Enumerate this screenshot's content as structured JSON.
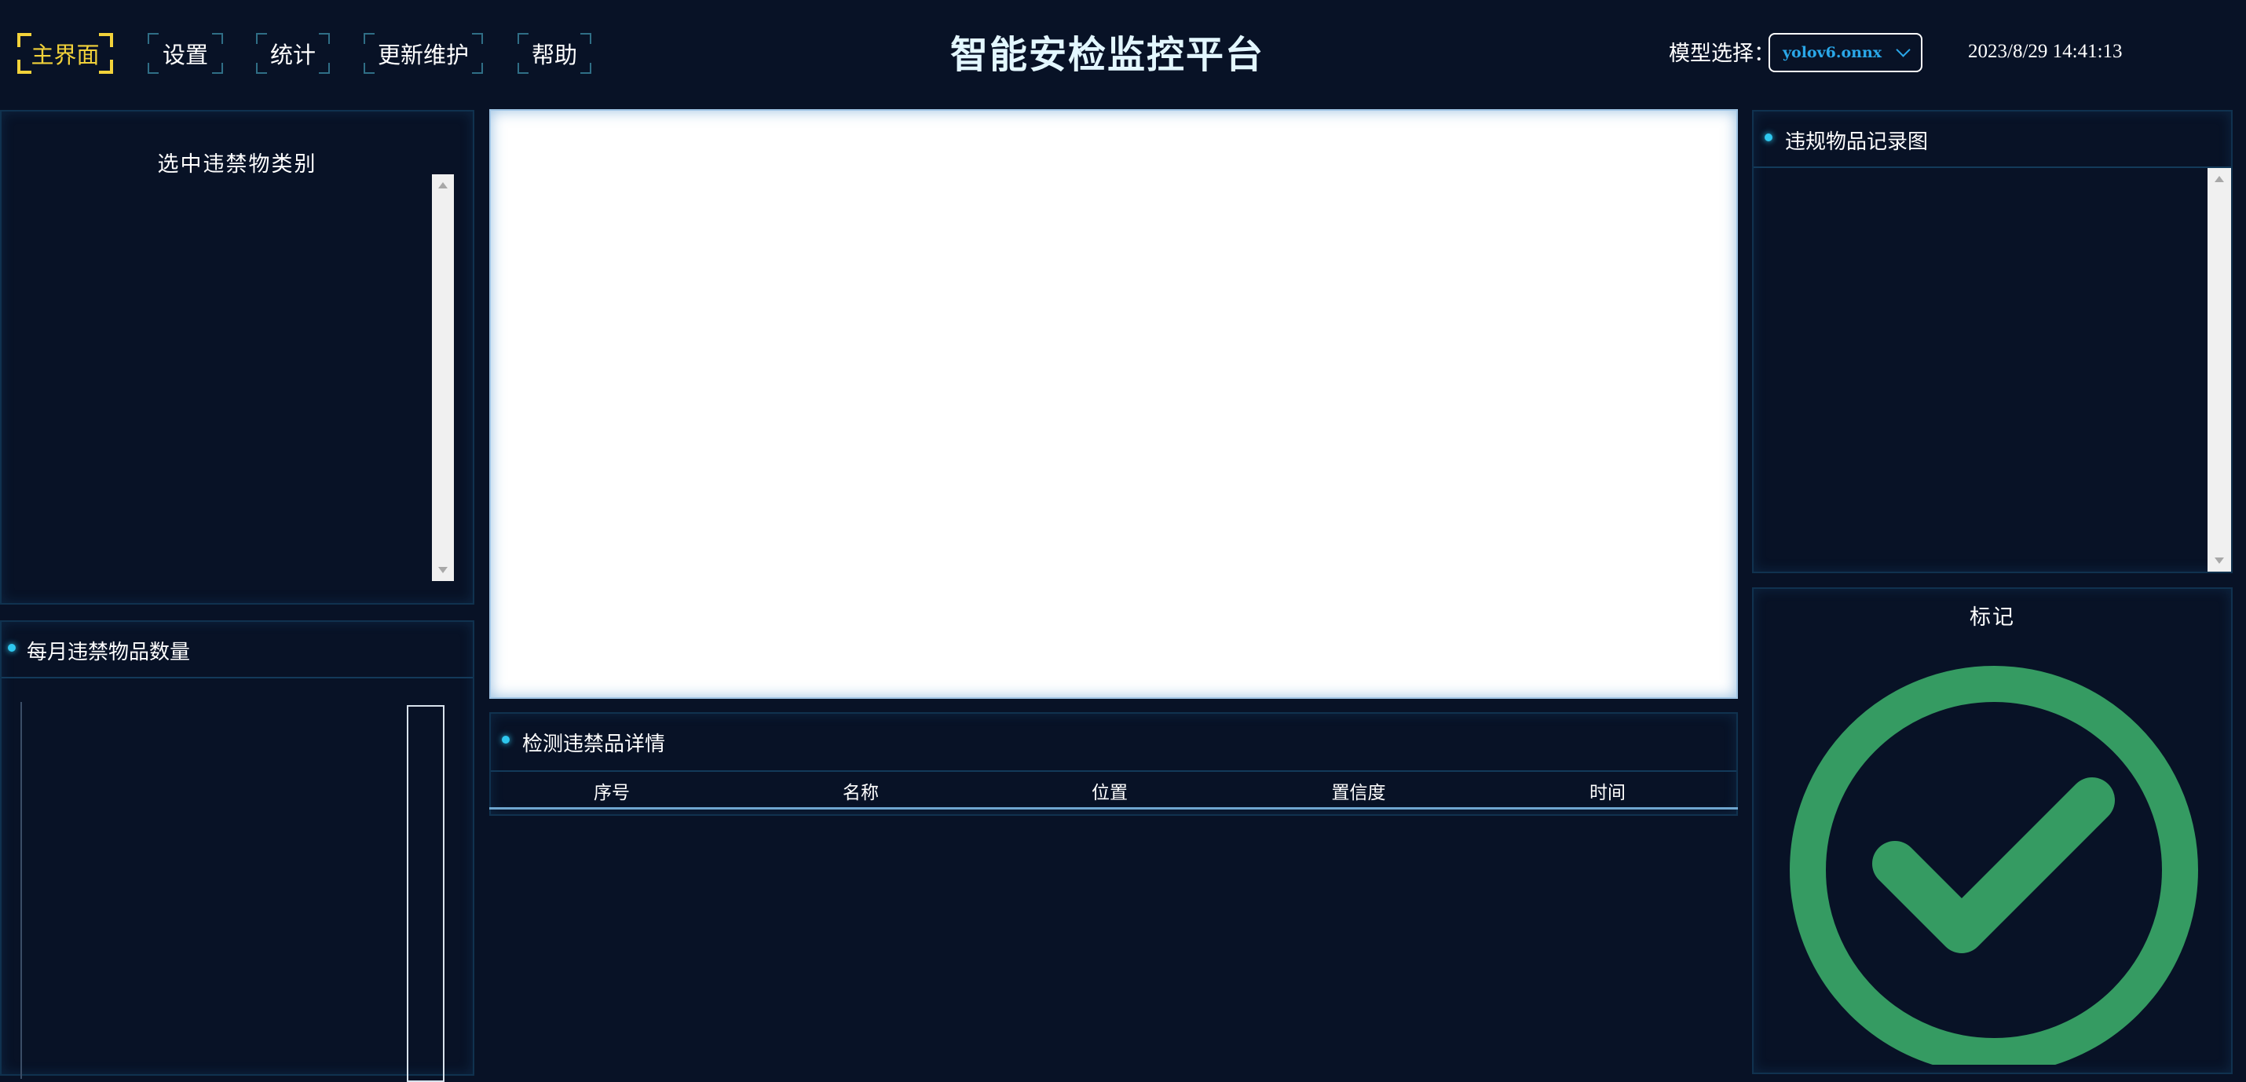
{
  "nav": {
    "items": [
      {
        "label": "主界面",
        "active": true
      },
      {
        "label": "设置",
        "active": false
      },
      {
        "label": "统计",
        "active": false
      },
      {
        "label": "更新维护",
        "active": false
      },
      {
        "label": "帮助",
        "active": false
      }
    ]
  },
  "header": {
    "title": "智能安检监控平台",
    "model_label": "模型选择：",
    "model_value": "yolov6.onnx",
    "datetime": "2023/8/29 14:41:13"
  },
  "left": {
    "category_title": "选中违禁物类别",
    "monthly_title": "每月违禁物品数量"
  },
  "center": {
    "details_title": "检测违禁品详情",
    "columns": [
      "序号",
      "名称",
      "位置",
      "置信度",
      "时间"
    ]
  },
  "right": {
    "record_title": "违规物品记录图",
    "mark_title": "标记",
    "mark_icon": "check-circle-icon"
  },
  "colors": {
    "background": "#081226",
    "panel_border": "#10324f",
    "accent_cyan": "#2ec8ef",
    "active_nav": "#f2d23a",
    "check_green": "#359b62"
  }
}
